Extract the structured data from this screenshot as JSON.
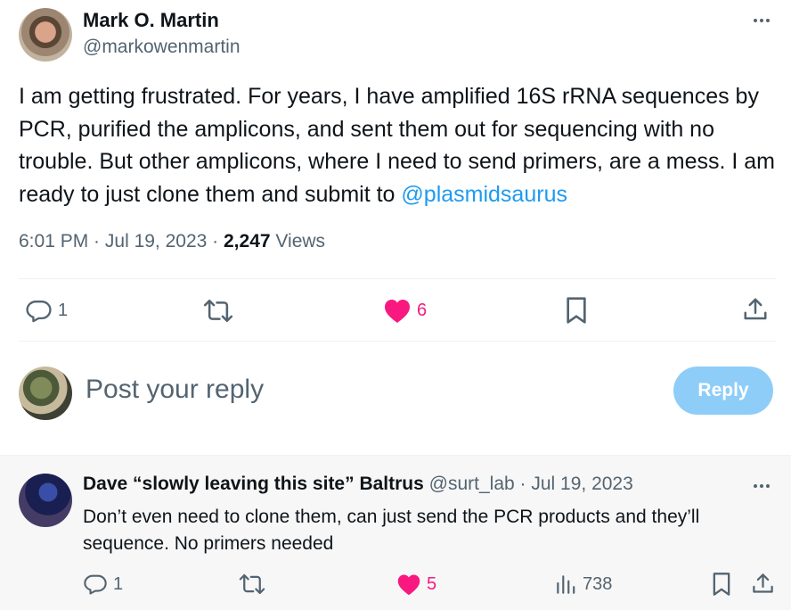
{
  "tweet": {
    "author_name": "Mark O. Martin",
    "author_handle": "@markowenmartin",
    "text_main": "I am getting frustrated.  For years, I have amplified 16S rRNA sequences by PCR, purified the amplicons, and sent them out for sequencing with no trouble.  But other amplicons, where I need to send primers, are a mess.  I am ready to just clone them and submit to ",
    "mention": "@plasmidsaurus",
    "time": "6:01 PM",
    "date": "Jul 19, 2023",
    "views_count": "2,247",
    "views_label": "Views",
    "reply_count": "1",
    "retweet_count": "",
    "like_count": "6"
  },
  "compose": {
    "placeholder": "Post your reply",
    "reply_label": "Reply"
  },
  "reply": {
    "author_name": "Dave “slowly leaving this site” Baltrus",
    "author_handle": "@surt_lab",
    "date": "Jul 19, 2023",
    "text": "Don’t even need to clone them, can just send the PCR products and they’ll sequence. No primers needed",
    "reply_count": "1",
    "like_count": "5",
    "views_count": "738"
  },
  "colors": {
    "accent": "#1d9bf0",
    "like": "#f91880",
    "muted": "#536471",
    "reply_button": "#8ecdf8"
  },
  "icons": [
    "reply-icon",
    "retweet-icon",
    "heart-icon",
    "bookmark-icon",
    "share-icon",
    "analytics-icon",
    "more-icon"
  ]
}
